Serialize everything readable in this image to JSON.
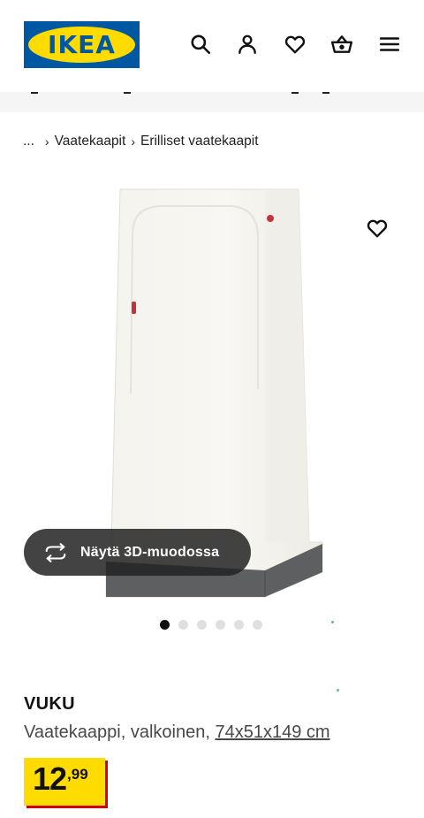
{
  "header": {
    "logo_text": "IKEA",
    "icons": [
      "search-icon",
      "account-icon",
      "heart-icon",
      "cart-icon",
      "menu-icon"
    ],
    "colors": {
      "logo_blue": "#0058a3",
      "logo_yellow": "#ffdb00"
    }
  },
  "breadcrumb": {
    "ellipsis": "...",
    "items": [
      "Vaatekaapit",
      "Erilliset vaatekaapit"
    ]
  },
  "gallery": {
    "view_3d_label": "Näytä 3D-muodossa",
    "dot_count": 6,
    "active_dot": 0
  },
  "product": {
    "name": "VUKU",
    "description": "Vaatekaappi, valkoinen, ",
    "measurement": "74x51x149 cm",
    "price_integer": "12",
    "price_decimals": ",99",
    "colors": {
      "price_bg": "#ffdb00",
      "price_shadow": "#cc0008"
    }
  }
}
